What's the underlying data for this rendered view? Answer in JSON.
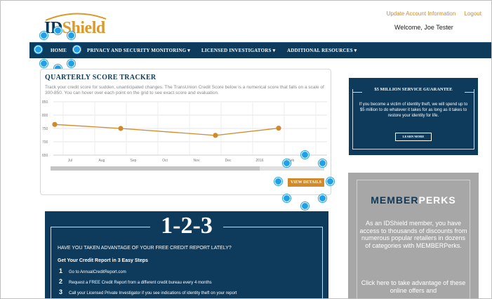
{
  "header": {
    "logo": {
      "id": "ID",
      "shield": "Shield"
    },
    "links": [
      "Update Account Information",
      "Logout"
    ],
    "welcome": "Welcome, Joe Tester"
  },
  "nav": {
    "items": [
      "HOME",
      "PRIVACY AND SECURITY MONITORING ▾",
      "LICENSED INVESTIGATORS ▾",
      "ADDITIONAL RESOURCES ▾"
    ]
  },
  "tracker": {
    "title": "QUARTERLY SCORE TRACKER",
    "description": "Track your credit score for sudden, unanticipated changes. The TransUnion Credit Score below is a numerical score that falls on a scale of 300-850. You can hover over each point on the grid to see exact score and evaluation.",
    "button": "VIEW DETAILS"
  },
  "chart_data": {
    "type": "line",
    "title": "",
    "xlabel": "",
    "ylabel": "",
    "y_ticks": [
      850,
      800,
      750,
      700,
      650
    ],
    "ylim": [
      650,
      850
    ],
    "x_ticks": [
      "Jul",
      "Aug",
      "Sep",
      "Oct",
      "Nov",
      "Dec",
      "2016",
      "Feb",
      "Ma"
    ],
    "series": [
      {
        "x": [
          "Jul",
          "Sep",
          "Dec",
          "Feb"
        ],
        "values": [
          765,
          750,
          724,
          751
        ],
        "color": "#d08a2b"
      }
    ],
    "grid": true
  },
  "promo": {
    "heading": "1-2-3",
    "question": "HAVE YOU TAKEN ADVANTAGE OF YOUR FREE CREDIT REPORT LATELY?",
    "subheading": "Get Your Credit Report in 3 Easy Steps",
    "steps": [
      {
        "num": "1",
        "text": "Go to AnnualCreditReport.com"
      },
      {
        "num": "2",
        "text": "Request a FREE Credit Report from a different credit bureau every 4 months"
      },
      {
        "num": "3",
        "text": "Call your Licensed Private Investigator if you see indications of identity theft on your report"
      }
    ]
  },
  "guarantee": {
    "title": "$5 MILLION SERVICE GUARANTEE",
    "body": "If you become a victim of identity theft, we will spend up to $5 million to do whatever it takes for as long as it takes to restore your identity for life.",
    "button": "LEARN MORE"
  },
  "perks": {
    "member": "MEMBER",
    "perks": "PERKS",
    "text": "As an IDShield member, you have access to thousands of discounts from numerous popular retailers in dozens of categories with MEMBERPerks.",
    "text2": "Click here to take advantage of these online offers and"
  },
  "colors": {
    "navy": "#0e3a5b",
    "orange": "#d08a2b",
    "highlight_dot": "#1fa0e8"
  }
}
